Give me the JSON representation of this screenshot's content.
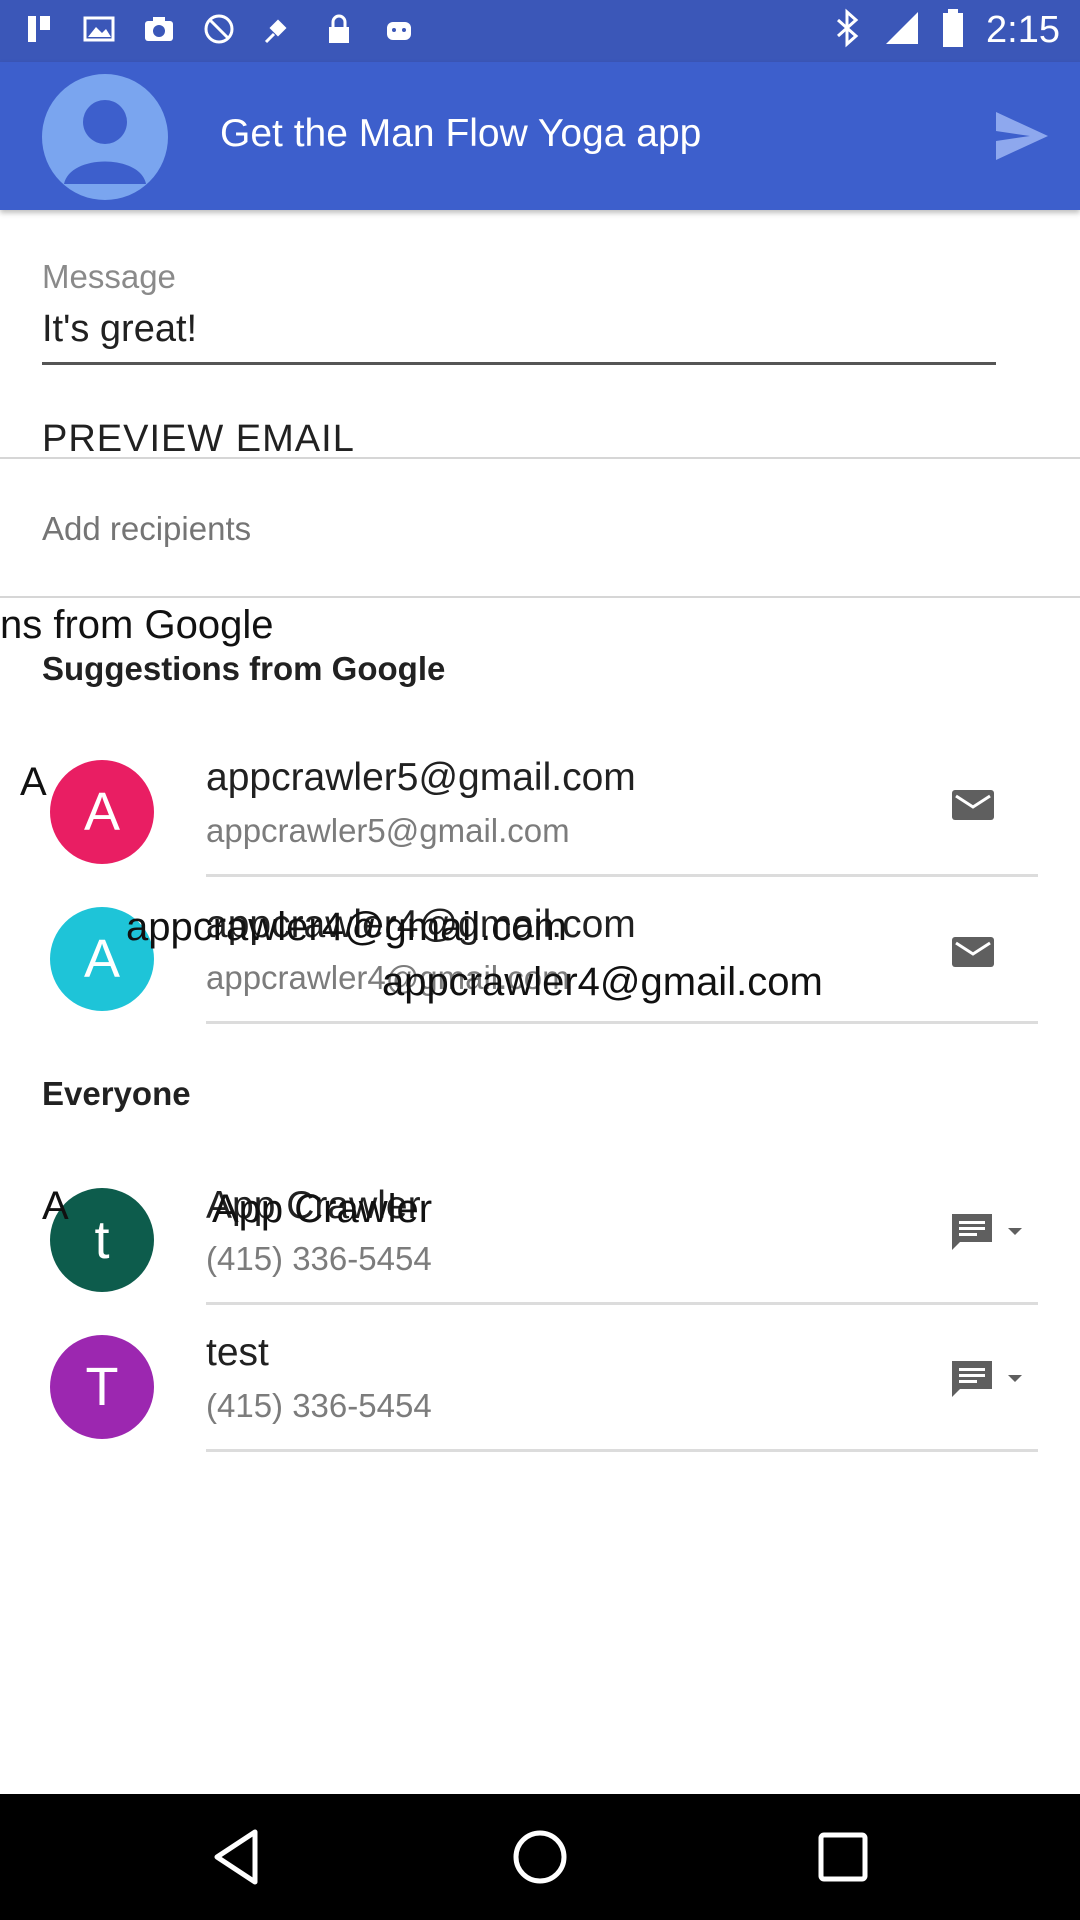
{
  "status_bar": {
    "time": "2:15",
    "icons": [
      "notification-icon",
      "image-icon",
      "camera-icon",
      "do-not-disturb-icon",
      "fake-gps-icon",
      "lock-icon",
      "android-icon",
      "bluetooth-icon",
      "signal-icon",
      "battery-icon"
    ]
  },
  "app_bar": {
    "title": "Get the Man Flow Yoga app",
    "avatar_icon": "account-avatar-icon",
    "send_icon": "send-icon"
  },
  "message": {
    "label": "Message",
    "value": "It's great!"
  },
  "preview_email_label": "PREVIEW EMAIL",
  "recipients": {
    "placeholder": "Add recipients"
  },
  "overlays": {
    "suggestions_ghost": "ns from Google",
    "letter_a1": "A",
    "letter_a2": "A",
    "row2_ghost_primary": "appcrawler4@gmail.com",
    "row2_ghost_secondary": "appcrawler4@gmail.com",
    "row3_ghost_primary": "App Crawler"
  },
  "suggestions": {
    "header": "Suggestions from Google",
    "items": [
      {
        "initial": "A",
        "primary": "appcrawler5@gmail.com",
        "secondary": "appcrawler5@gmail.com",
        "action_icon": "email-icon",
        "color": "#e91e63"
      },
      {
        "initial": "A",
        "primary": "appcrawler4@gmail.com",
        "secondary": "appcrawler4@gmail.com",
        "action_icon": "email-icon",
        "color": "#1ec4d8"
      }
    ]
  },
  "everyone": {
    "header": "Everyone",
    "items": [
      {
        "initial": "t",
        "primary": "App Crawler",
        "secondary": "(415) 336-5454",
        "action_icon": "message-dropdown-icon",
        "color": "#0d5c4c"
      },
      {
        "initial": "T",
        "primary": "test",
        "secondary": "(415) 336-5454",
        "action_icon": "message-dropdown-icon",
        "color": "#9c27b0"
      }
    ]
  },
  "nav_bar": {
    "back_icon": "back-icon",
    "home_icon": "home-icon",
    "recents_icon": "recents-icon"
  }
}
